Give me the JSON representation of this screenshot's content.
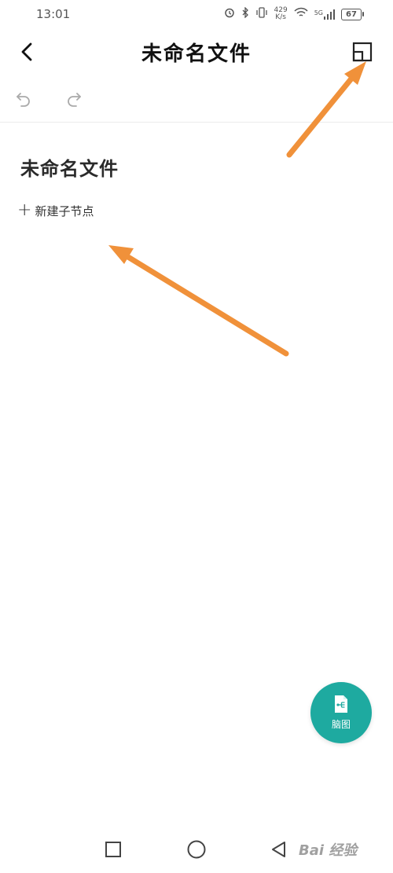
{
  "status_bar": {
    "time": "13:01",
    "net_speed_value": "429",
    "net_speed_unit": "K/s",
    "signal_label": "5G",
    "battery": "67",
    "icons": [
      "alarm-icon",
      "bluetooth-icon",
      "vibrate-icon",
      "wifi-icon",
      "signal-icon",
      "battery-icon"
    ]
  },
  "header": {
    "title": "未命名文件",
    "back_icon": "chevron-left-icon",
    "outline_icon": "window-resize-icon"
  },
  "toolbar": {
    "undo_icon": "undo-icon",
    "redo_icon": "redo-icon"
  },
  "document": {
    "root_title": "未命名文件",
    "add_child_label": "新建子节点",
    "add_child_icon": "plus-icon"
  },
  "fab": {
    "label": "脑图",
    "icon": "mindmap-file-icon",
    "color": "#1eaaa0"
  },
  "nav_bar": {
    "icons": [
      "square-recent-icon",
      "circle-home-icon",
      "triangle-back-icon"
    ]
  },
  "annotations": {
    "arrow_color": "#f0913a"
  },
  "watermark": {
    "text": "Bai 经验"
  }
}
